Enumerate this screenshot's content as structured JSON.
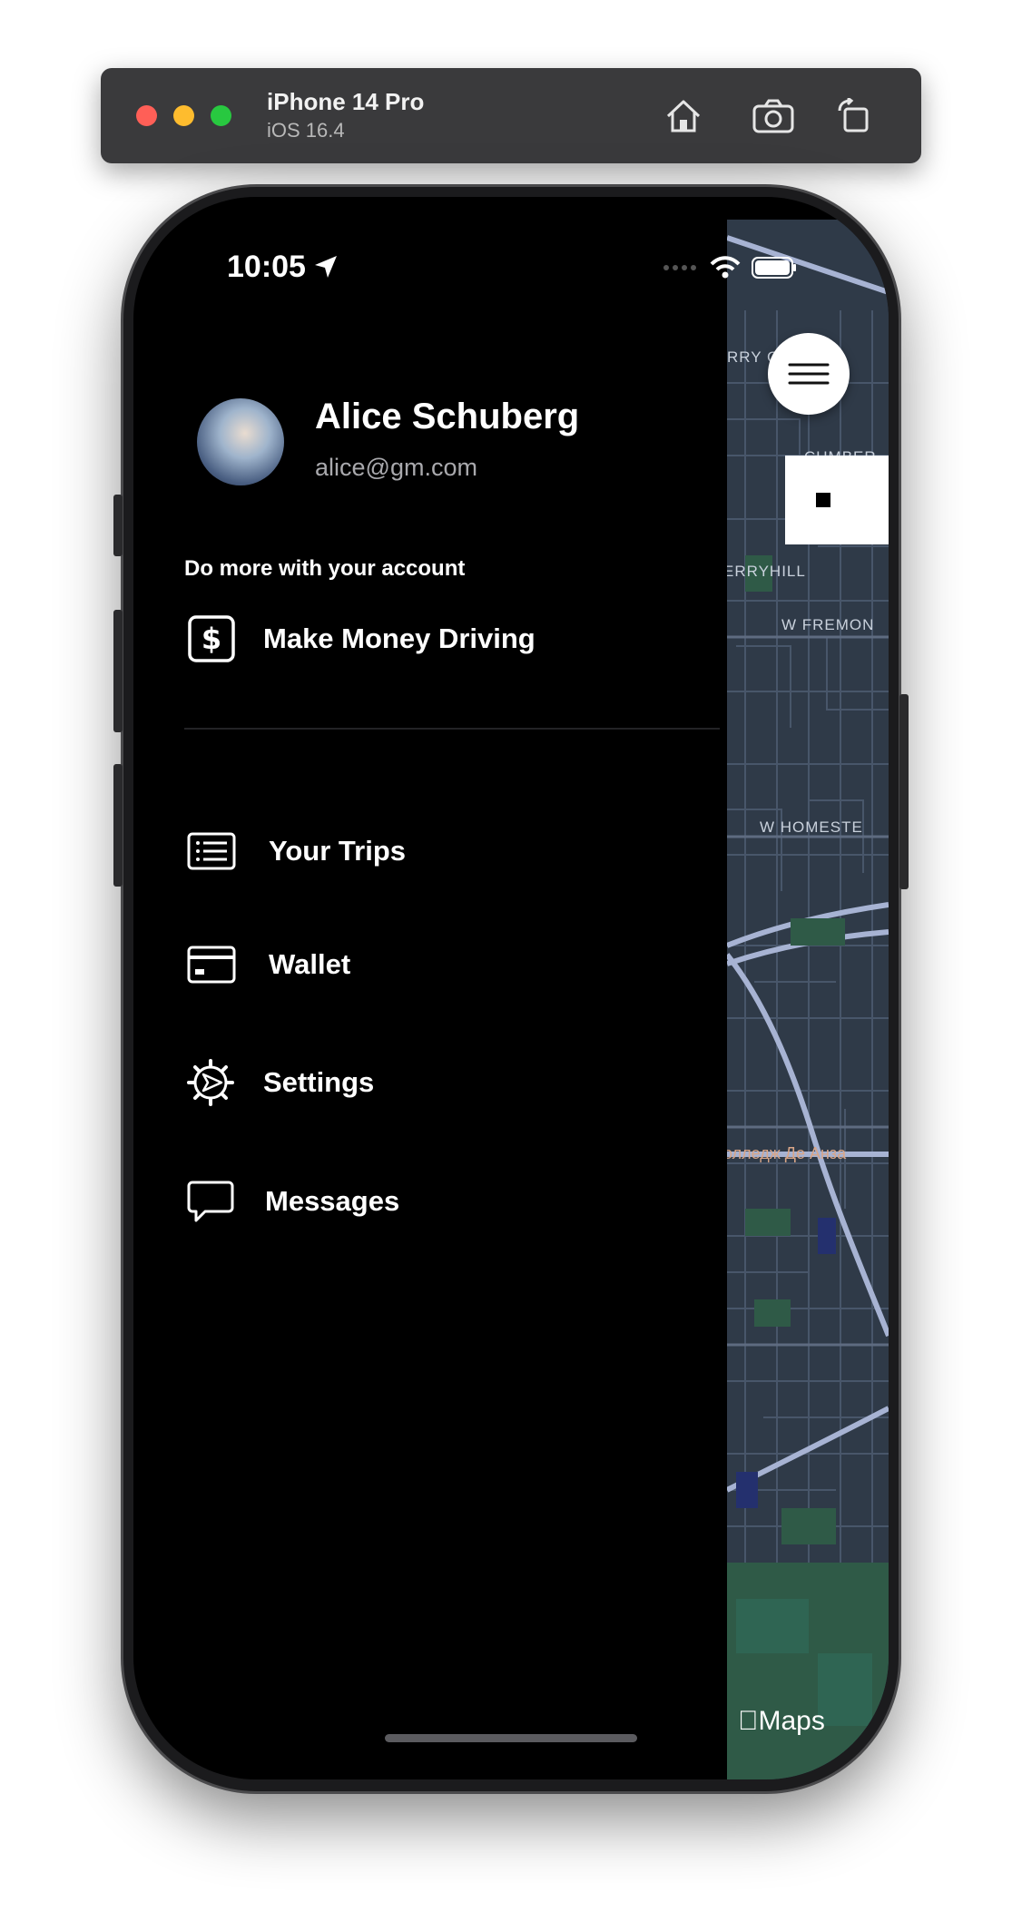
{
  "simulator": {
    "device_name": "iPhone 14 Pro",
    "os_version": "iOS 16.4",
    "buttons": [
      "home-icon",
      "screenshot-icon",
      "rotate-icon"
    ]
  },
  "status_bar": {
    "time": "10:05"
  },
  "drawer": {
    "user_name": "Alice Schuberg",
    "user_email": "alice@gm.com",
    "section_title": "Do more with your account",
    "promo_item": {
      "label": "Make Money Driving",
      "icon": "dollar-sign-icon"
    },
    "menu_items": [
      {
        "label": "Your Trips",
        "icon": "receipt-list-icon"
      },
      {
        "label": "Wallet",
        "icon": "credit-card-icon"
      },
      {
        "label": "Settings",
        "icon": "settings-gear-icon"
      },
      {
        "label": "Messages",
        "icon": "chat-bubble-icon"
      }
    ]
  },
  "map": {
    "labels": [
      "RRY CH",
      "CUMBER",
      "ERRYHILL",
      "W FREMON",
      "W HOMESTE",
      "олледж Де Анза"
    ],
    "attribution": "Maps"
  },
  "colors": {
    "background": "#000000",
    "map_base": "#2f3a48",
    "text_primary": "#ffffff",
    "text_secondary": "#a9a9ad"
  }
}
